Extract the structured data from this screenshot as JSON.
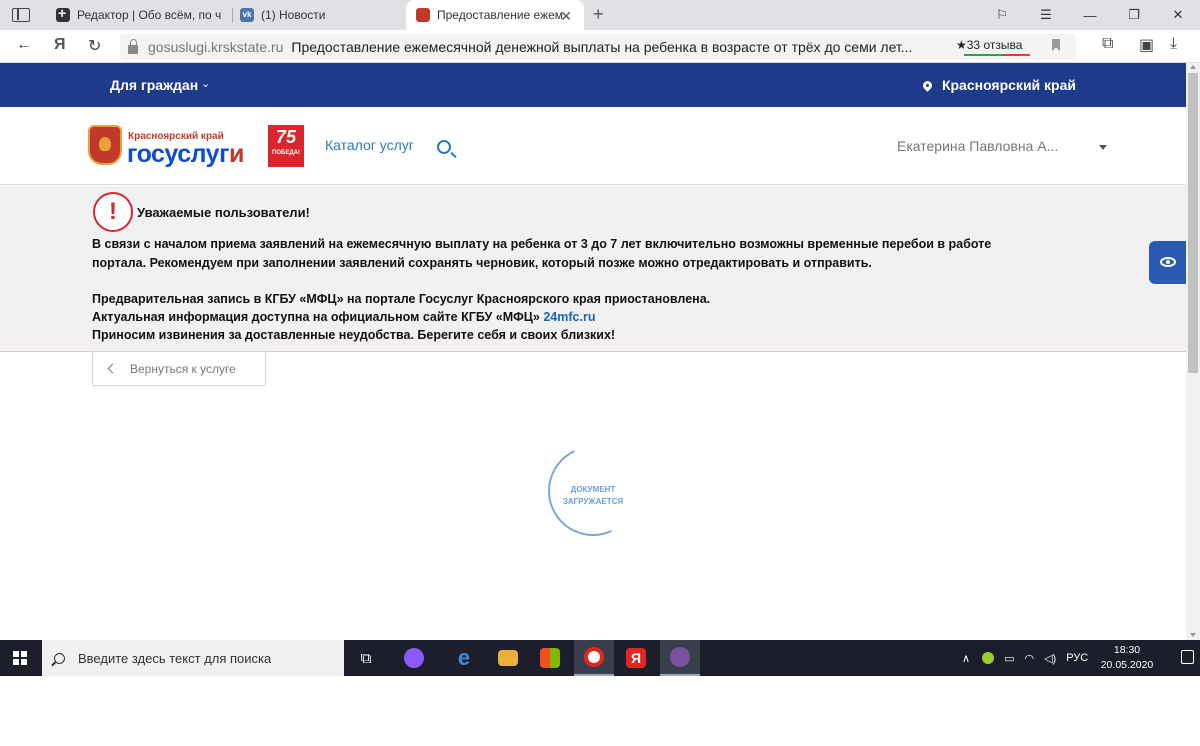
{
  "browser": {
    "tabs": [
      {
        "label": "Редактор | Обо всём, по ч"
      },
      {
        "label": "(1) Новости"
      },
      {
        "label": "Предоставление ежем",
        "close": "✕"
      }
    ],
    "new_tab": "+",
    "address": {
      "domain": "gosuslugi.krskstate.ru",
      "page_title": "Предоставление ежемесячной денежной выплаты на ребенка в возрасте от трёх до семи лет...",
      "reviews": "★33 отзыва"
    },
    "window_controls": {
      "minimize": "—",
      "maximize": "❐",
      "close": "✕"
    }
  },
  "site": {
    "topbar": {
      "for_citizens": "Для граждан",
      "region": "Красноярский край"
    },
    "header": {
      "logo_region": "Красноярский край",
      "logo_main_blue": "госуслуг",
      "logo_main_red": "и",
      "badge_number": "75",
      "badge_text": "ПОБЕДА!",
      "catalog": "Каталог услуг",
      "user_name": "Екатерина Павловна А..."
    },
    "notice": {
      "icon": "!",
      "title": "Уважаемые пользователи!",
      "line1": "В связи с началом приема заявлений на ежемесячную выплату на ребенка от 3 до 7 лет включительно возможны временные перебои в работе",
      "line2": "портала. Рекомендуем при заполнении заявлений сохранять черновик, который позже можно отредактировать и отправить.",
      "line3": "Предварительная запись в КГБУ «МФЦ» на портале Госуслуг Красноярского края приостановлена.",
      "line4_prefix": "Актуальная информация доступна на официальном сайте КГБУ «МФЦ» ",
      "line4_link": "24mfc.ru",
      "line5": "Приносим извинения за доставленные неудобства. Берегите себя и своих близких!"
    },
    "back_button": "Вернуться к услуге",
    "loader": {
      "line1": "ДОКУМЕНТ",
      "line2": "ЗАГРУЖАЕТСЯ"
    }
  },
  "taskbar": {
    "search_placeholder": "Введите здесь текст для поиска",
    "language": "РУС",
    "time": "18:30",
    "date": "20.05.2020"
  },
  "colors": {
    "topbar": "#1e3a8a",
    "accent_blue": "#2b7ab8",
    "alert_red": "#d7262f",
    "link": "#1a65b5"
  }
}
